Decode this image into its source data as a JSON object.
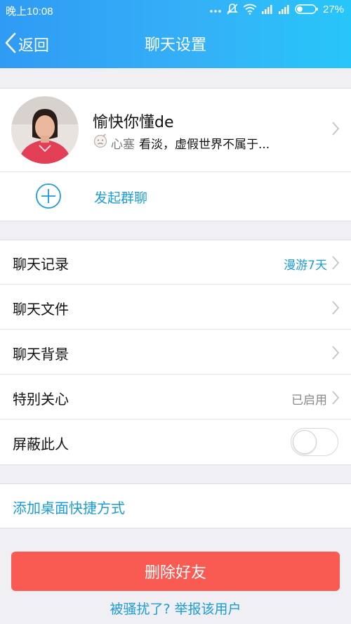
{
  "status_bar": {
    "time": "晚上10:08",
    "battery": "27%"
  },
  "nav": {
    "back_label": "返回",
    "title": "聊天设置"
  },
  "profile": {
    "nickname": "愉快你懂de",
    "signature_badge": "心塞",
    "signature_text": "看淡，虚假世界不属于..."
  },
  "group_chat": {
    "label": "发起群聊"
  },
  "settings": [
    {
      "label": "聊天记录",
      "value": "漫游7天",
      "value_color": "#1b9cd6",
      "chevron": true
    },
    {
      "label": "聊天文件",
      "value": "",
      "value_color": "#8a8a8a",
      "chevron": true
    },
    {
      "label": "聊天背景",
      "value": "",
      "value_color": "#8a8a8a",
      "chevron": true
    },
    {
      "label": "特别关心",
      "value": "已启用",
      "value_color": "#8a8a8a",
      "chevron": true
    },
    {
      "label": "屏蔽此人",
      "value": "",
      "value_color": "#8a8a8a",
      "chevron": false,
      "toggle": false
    }
  ],
  "shortcut": {
    "label": "添加桌面快捷方式"
  },
  "delete_button": {
    "label": "删除好友"
  },
  "report_link": {
    "label": "被骚扰了? 举报该用户"
  },
  "colors": {
    "accent": "#1b9cd6",
    "danger": "#f95a52",
    "header_start": "#2f9bf4",
    "header_end": "#27c6f9"
  }
}
